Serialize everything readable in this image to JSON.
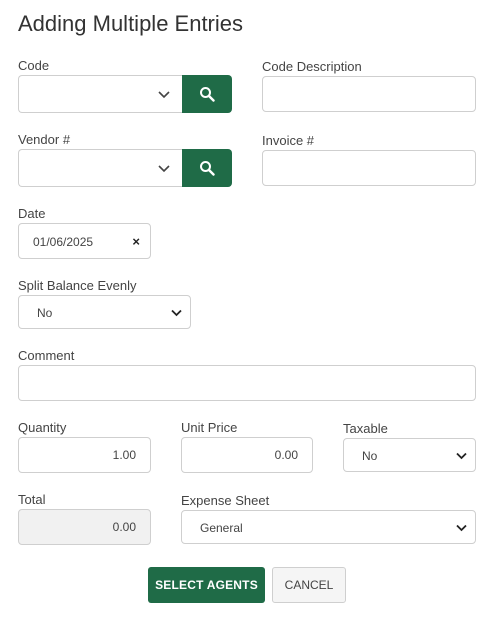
{
  "title": "Adding Multiple Entries",
  "code": {
    "label": "Code",
    "value": ""
  },
  "code_description": {
    "label": "Code Description",
    "value": ""
  },
  "vendor": {
    "label": "Vendor #",
    "value": ""
  },
  "invoice": {
    "label": "Invoice #",
    "value": ""
  },
  "date": {
    "label": "Date",
    "value": "01/06/2025",
    "clear_glyph": "×"
  },
  "split_balance": {
    "label": "Split Balance Evenly",
    "value": "No"
  },
  "comment": {
    "label": "Comment",
    "value": ""
  },
  "quantity": {
    "label": "Quantity",
    "value": "1.00"
  },
  "unit_price": {
    "label": "Unit Price",
    "value": "0.00"
  },
  "taxable": {
    "label": "Taxable",
    "value": "No"
  },
  "total": {
    "label": "Total",
    "value": "0.00"
  },
  "expense_sheet": {
    "label": "Expense Sheet",
    "value": "General"
  },
  "actions": {
    "select_agents": "SELECT AGENTS",
    "cancel": "CANCEL"
  },
  "colors": {
    "primary": "#1f6b47",
    "border": "#cfcfcf",
    "readonly_bg": "#f1f1f1"
  },
  "icons": {
    "search": "search-icon",
    "dropdown": "chevron-down-icon",
    "clear": "close-icon"
  }
}
